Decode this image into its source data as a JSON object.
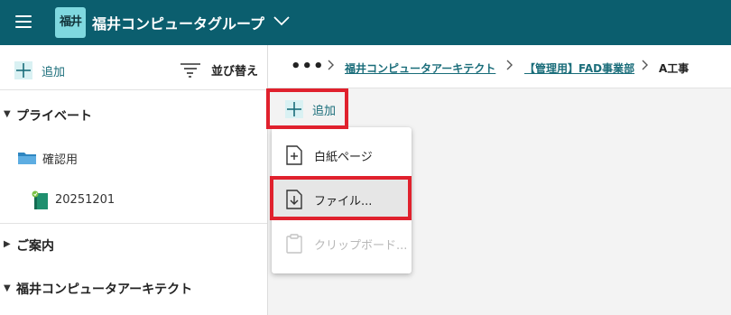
{
  "header": {
    "logo_text": "福井",
    "title": "福井コンピュータグループ",
    "bg_color": "#0b5e6e"
  },
  "sidebar": {
    "add_label": "追加",
    "sort_label": "並び替え",
    "sections": [
      {
        "label": "プライベート",
        "expanded": true
      },
      {
        "label": "ご案内",
        "expanded": false
      },
      {
        "label": "福井コンピュータアーキテクト",
        "expanded": true
      }
    ],
    "private_items": [
      {
        "label": "確認用",
        "icon": "folder-icon"
      },
      {
        "label": "20251201",
        "icon": "notebook-icon"
      }
    ]
  },
  "breadcrumb": {
    "more": "•••",
    "items": [
      "福井コンピュータアーキテクト",
      "【管理用】FAD事業部"
    ],
    "current": "A工事"
  },
  "main": {
    "add_label": "追加"
  },
  "add_menu": {
    "items": [
      {
        "label": "白紙ページ",
        "icon": "blank-page-icon",
        "enabled": true
      },
      {
        "label": "ファイル...",
        "icon": "file-download-icon",
        "enabled": true,
        "highlighted": true
      },
      {
        "label": "クリップボード...",
        "icon": "clipboard-icon",
        "enabled": false
      }
    ]
  },
  "colors": {
    "accent": "#1a6d7a",
    "highlight_box": "#e0212d"
  }
}
